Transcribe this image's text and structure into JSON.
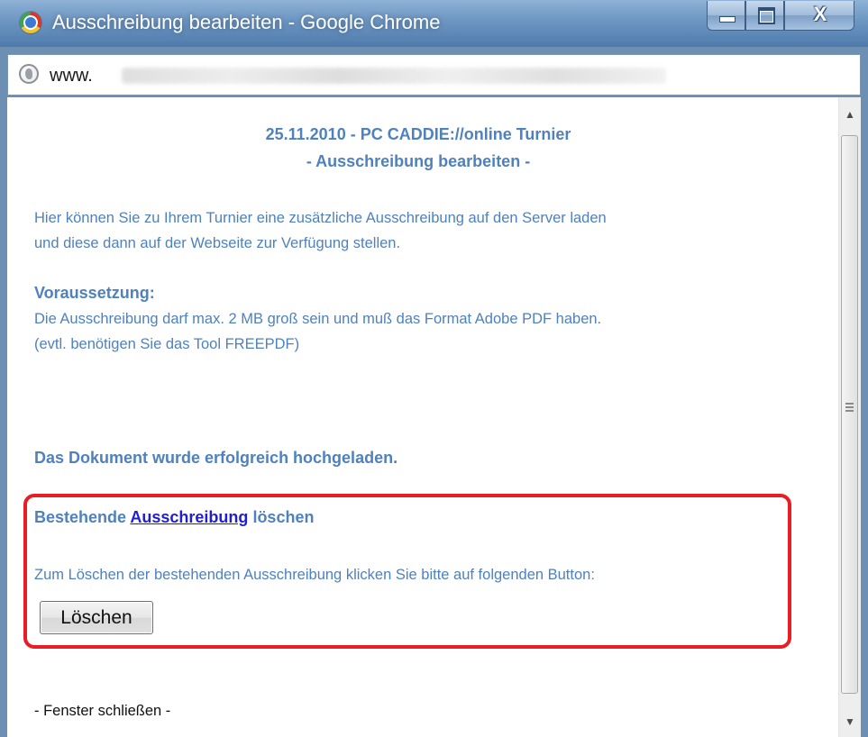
{
  "window": {
    "title": "Ausschreibung bearbeiten - Google Chrome",
    "controls": {
      "close_glyph": "X"
    }
  },
  "address_bar": {
    "url_visible_prefix": "www."
  },
  "page": {
    "heading_line1": "25.11.2010 - PC CADDIE://online Turnier",
    "heading_line2": "- Ausschreibung bearbeiten -",
    "intro_line1": "Hier können Sie zu Ihrem Turnier eine zusätzliche Ausschreibung auf den Server laden",
    "intro_line2": "und diese dann auf der Webseite zur Verfügung stellen.",
    "requirement_title": "Voraussetzung:",
    "requirement_line1": "Die Ausschreibung darf max. 2 MB groß sein und muß das Format Adobe PDF haben.",
    "requirement_line2": "(evtl. benötigen Sie das Tool FREEPDF)",
    "upload_success": "Das Dokument wurde erfolgreich hochgeladen.",
    "delete_section": {
      "title_prefix": "Bestehende",
      "title_link": "Ausschreibung",
      "title_suffix": "löschen",
      "instruction": "Zum Löschen der bestehenden Ausschreibung klicken Sie bitte auf folgenden Button:",
      "button_label": "Löschen",
      "highlight_color": "#ea1c24"
    },
    "close_window_link": "- Fenster schließen -"
  },
  "colors": {
    "text_blue": "#4f81bd",
    "link_blue": "#1f1fd1",
    "titlebar": "#6c95c2"
  },
  "icons": {
    "title_icon": "chrome-icon",
    "address_icon": "globe-icon"
  }
}
